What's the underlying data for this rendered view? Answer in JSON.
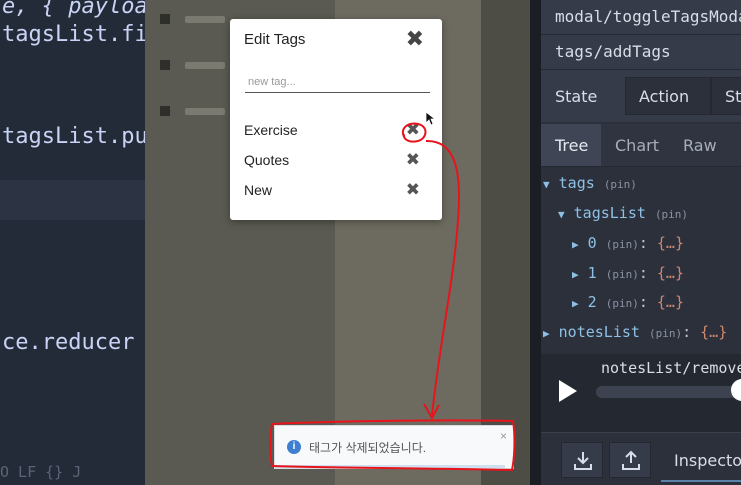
{
  "editor": {
    "lines": [
      {
        "text": "e, { payloa",
        "style": "italic"
      },
      {
        "text": "tagsList.fi",
        "style": "normal"
      },
      {
        "text": "tagsList.pu",
        "style": "normal"
      },
      {
        "text": "ce.reducer",
        "style": "normal"
      }
    ],
    "statusbar": "O  LF  {} J"
  },
  "modal": {
    "title": "Edit Tags",
    "close_glyph": "✖",
    "input_placeholder": "new tag...",
    "tags": [
      "Exercise",
      "Quotes",
      "New"
    ],
    "delete_glyph": "✖"
  },
  "toast": {
    "message": "태그가 삭제되었습니다.",
    "info_glyph": "i",
    "close_glyph": "×"
  },
  "devtools": {
    "actions": [
      "modal/toggleTagsModal",
      "tags/addTags"
    ],
    "panel_label": "State",
    "panel_tabs": [
      "Action",
      "St"
    ],
    "view_tabs": [
      "Tree",
      "Chart",
      "Raw"
    ],
    "active_view_tab": "Tree",
    "tree": {
      "root": "tags",
      "child": "tagsList",
      "items": [
        "0",
        "1",
        "2"
      ],
      "sibling": "notesList",
      "pin": "(pin)",
      "ellipsis": "{…}"
    },
    "player_action": "notesList/remove",
    "inspector_label": "Inspecto"
  },
  "colors": {
    "annotation": "#e8141c",
    "accent": "#5e81ac"
  }
}
